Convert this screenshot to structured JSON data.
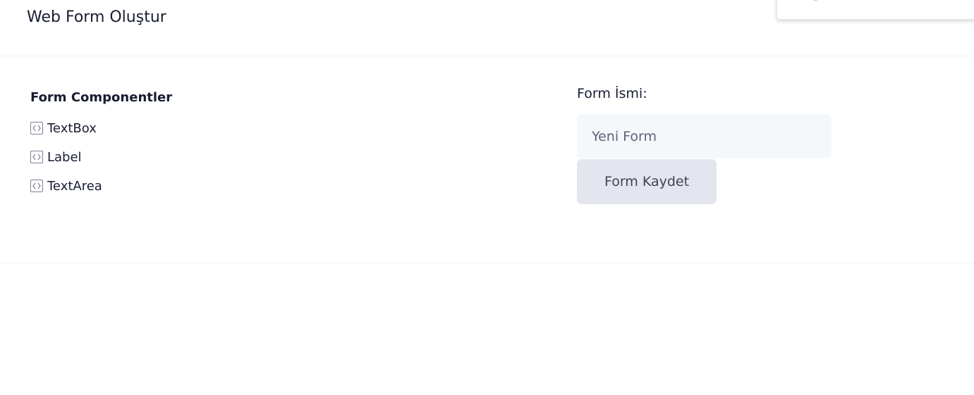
{
  "header": {
    "title": "Web Form Oluştur"
  },
  "components": {
    "title": "Form Componentler",
    "items": [
      {
        "label": "TextBox",
        "icon": "code-icon"
      },
      {
        "label": "Label",
        "icon": "code-icon"
      },
      {
        "label": "TextArea",
        "icon": "code-icon"
      }
    ]
  },
  "form": {
    "name_label": "Form İsmi:",
    "name_value": "Yeni Form",
    "save_label": "Form Kaydet"
  },
  "colors": {
    "text_dark": "#181c32",
    "input_bg": "#f5f8fa",
    "button_bg": "#e4e6ef",
    "divider": "#eff2f5"
  }
}
